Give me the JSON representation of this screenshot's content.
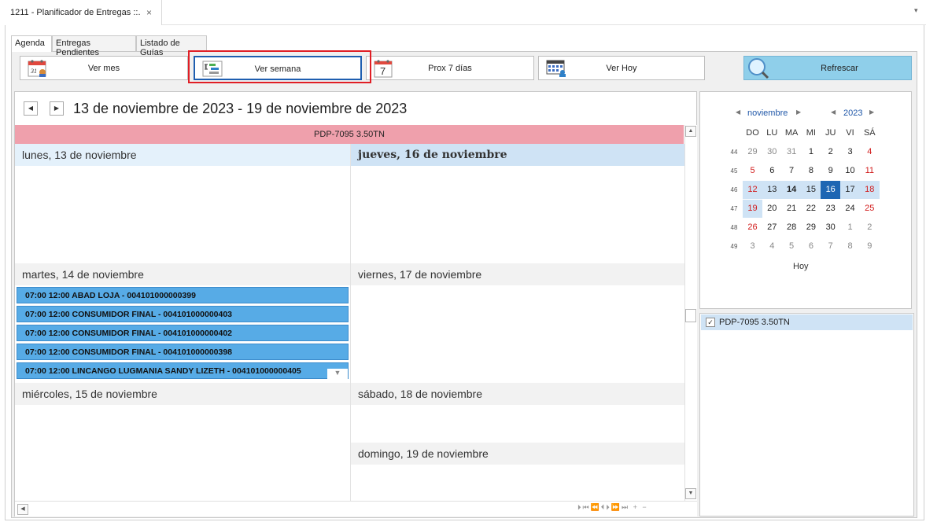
{
  "document_tab": {
    "title": "1211 - Planificador de Entregas ::.",
    "close": "×"
  },
  "inner_tabs": [
    "Agenda",
    "Entregas Pendientes",
    "Listado de Guías"
  ],
  "toolbar": {
    "month_label": "Ver mes",
    "week_label": "Ver semana",
    "next7_label": "Prox 7 días",
    "today_label": "Ver Hoy",
    "refresh_label": "Refrescar"
  },
  "scheduler": {
    "date_range": "13 de noviembre de 2023 - 19 de noviembre de 2023",
    "resource_header": "PDP-7095  3.50TN",
    "days": {
      "mon": "lunes, 13 de noviembre",
      "tue": "martes, 14 de noviembre",
      "wed": "miércoles, 15 de noviembre",
      "thu": "jueves, 16 de noviembre",
      "fri": "viernes, 17 de noviembre",
      "sat": "sábado, 18 de noviembre",
      "sun": "domingo, 19 de noviembre"
    },
    "appointments": [
      "07:00  12:00  ABAD LOJA - 004101000000399",
      "07:00  12:00  CONSUMIDOR FINAL - 004101000000403",
      "07:00  12:00  CONSUMIDOR FINAL - 004101000000402",
      "07:00  12:00  CONSUMIDOR FINAL - 004101000000398",
      "07:00  12:00  LINCANGO LUGMANIA SANDY LIZETH - 004101000000405"
    ],
    "pager": "⏵⏮⏪⏴⏵⏩⏭ + −"
  },
  "calendar": {
    "month": "noviembre",
    "year": "2023",
    "weekdays": [
      "DO",
      "LU",
      "MA",
      "MI",
      "JU",
      "VI",
      "SÁ"
    ],
    "weeks": [
      {
        "num": "44",
        "days": [
          "29",
          "30",
          "31",
          "1",
          "2",
          "3",
          "4"
        ]
      },
      {
        "num": "45",
        "days": [
          "5",
          "6",
          "7",
          "8",
          "9",
          "10",
          "11"
        ]
      },
      {
        "num": "46",
        "days": [
          "12",
          "13",
          "14",
          "15",
          "16",
          "17",
          "18"
        ]
      },
      {
        "num": "47",
        "days": [
          "19",
          "20",
          "21",
          "22",
          "23",
          "24",
          "25"
        ]
      },
      {
        "num": "48",
        "days": [
          "26",
          "27",
          "28",
          "29",
          "30",
          "1",
          "2"
        ]
      },
      {
        "num": "49",
        "days": [
          "3",
          "4",
          "5",
          "6",
          "7",
          "8",
          "9"
        ]
      }
    ],
    "today_button": "Hoy"
  },
  "resources": [
    {
      "label": "PDP-7095  3.50TN",
      "checked": true
    }
  ]
}
